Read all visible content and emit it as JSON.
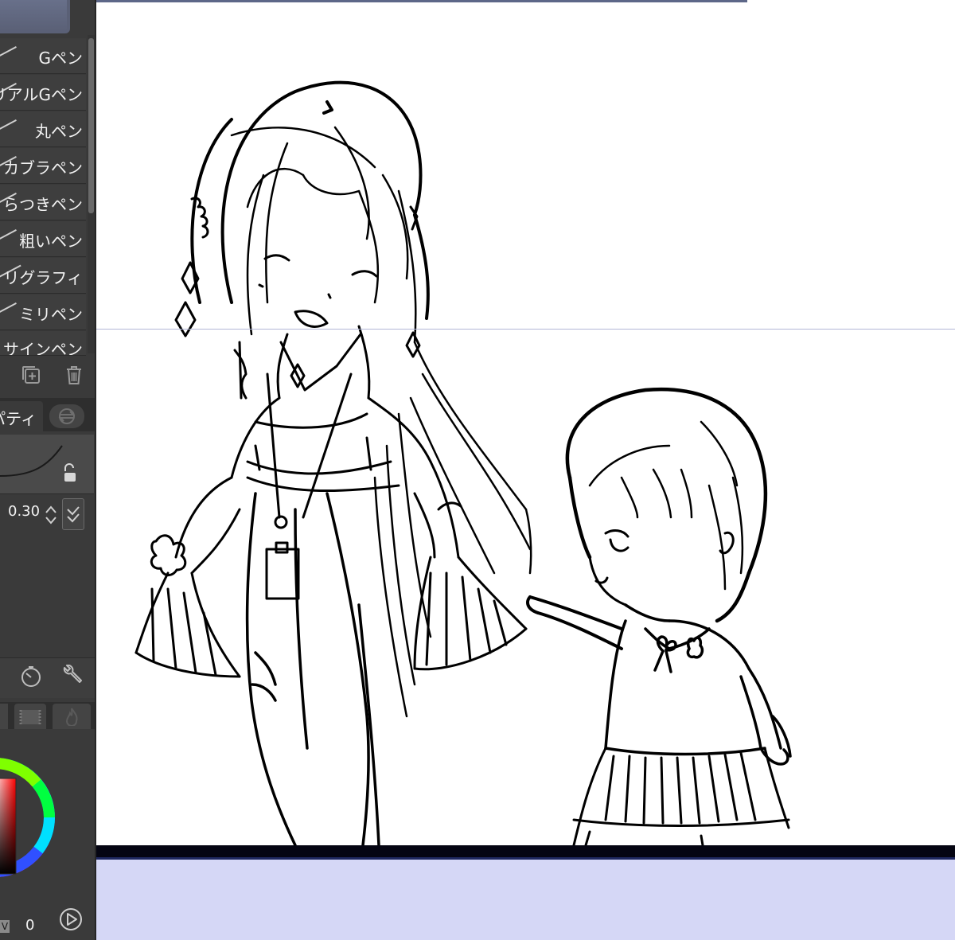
{
  "brush_list": {
    "items": [
      {
        "label": "Gペン"
      },
      {
        "label": "リアルGペン"
      },
      {
        "label": "丸ペン"
      },
      {
        "label": "カブラペン"
      },
      {
        "label": "らつきペン"
      },
      {
        "label": "粗いペン"
      },
      {
        "label": "リグラフィ"
      },
      {
        "label": "ミリペン"
      },
      {
        "label": "サインペン"
      }
    ]
  },
  "toolbar": {
    "add_icon": "add-brush-icon",
    "delete_icon": "trash-icon"
  },
  "property_panel": {
    "tab_label": "パティ",
    "value": "0.30"
  },
  "color_panel": {
    "v_label": "V",
    "v_value": "0",
    "ring_hue_colors": [
      "#ff0000",
      "#ffff00",
      "#00ff00",
      "#00ffff",
      "#0000ff",
      "#ff00ff",
      "#ff0000"
    ],
    "square_color": "#cc0000"
  },
  "canvas": {
    "background": "#ffffff",
    "lower_area_color": "#d5d7f6"
  }
}
